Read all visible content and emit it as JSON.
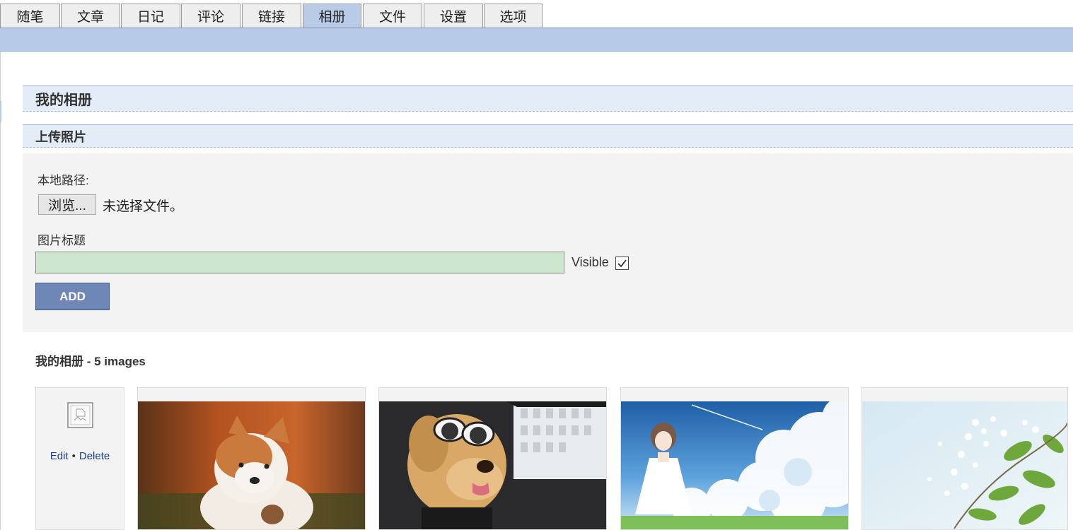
{
  "tabs": [
    {
      "label": "随笔",
      "active": false
    },
    {
      "label": "文章",
      "active": false
    },
    {
      "label": "日记",
      "active": false
    },
    {
      "label": "评论",
      "active": false
    },
    {
      "label": "链接",
      "active": false
    },
    {
      "label": "相册",
      "active": true
    },
    {
      "label": "文件",
      "active": false
    },
    {
      "label": "设置",
      "active": false
    },
    {
      "label": "选项",
      "active": false
    }
  ],
  "album": {
    "heading": "我的相册"
  },
  "upload": {
    "heading": "上传照片",
    "path_label": "本地路径:",
    "browse_label": "浏览...",
    "no_file_text": "未选择文件。",
    "title_label": "图片标题",
    "title_value": "",
    "visible_label": "Visible",
    "visible_checked": true,
    "add_label": "ADD"
  },
  "gallery": {
    "title": "我的相册 - 5 images",
    "first_card": {
      "icon": "broken-image-icon",
      "edit_label": "Edit",
      "separator": "•",
      "delete_label": "Delete"
    },
    "photos": [
      {
        "subject": "akita-puppy"
      },
      {
        "subject": "dog-with-sunglasses"
      },
      {
        "subject": "anime-girl-sky"
      },
      {
        "subject": "white-blossoms"
      }
    ]
  },
  "colors": {
    "tab_active": "#b9cbe7",
    "band": "#b7cae7",
    "section_header_bg": "#e3ecf7",
    "input_bg": "#cde7cf",
    "add_button": "#6f87b6",
    "link": "#1c3f94"
  }
}
